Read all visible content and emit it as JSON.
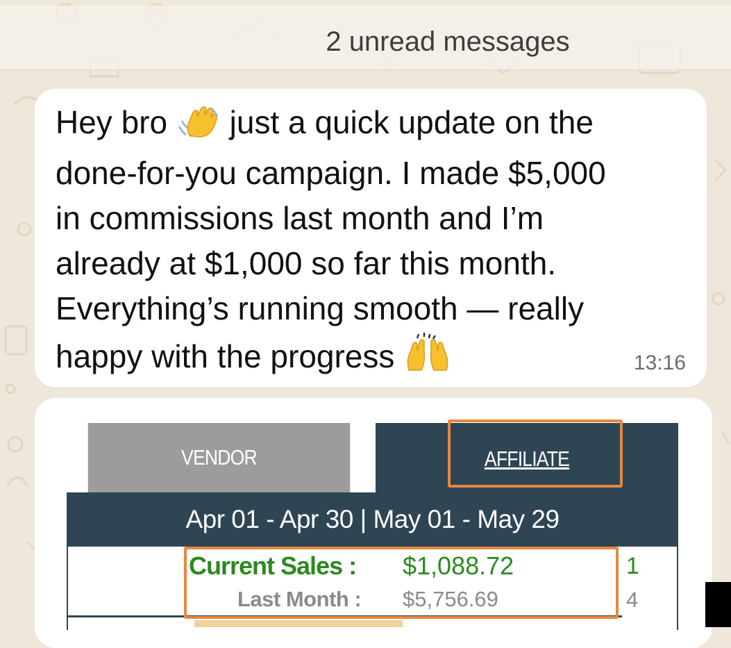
{
  "unread": {
    "label": "2 unread messages"
  },
  "message": {
    "lines": [
      "Hey bro",
      "just a quick update on the",
      "done-for-you campaign. I made $5,000",
      "in commissions last month and I’m",
      "already at $1,000 so far this month.",
      "Everything’s running smooth — really",
      "happy with the progress"
    ],
    "time": "13:16",
    "emoji_1": "waving-hand",
    "emoji_2": "raising-hands"
  },
  "screenshot": {
    "tab_vendor": "VENDOR",
    "tab_affiliate": "AFFILIATE",
    "date_range": "Apr 01 - Apr 30 | May 01 - May 29",
    "current_sales_label": "Current Sales :",
    "current_sales_value": "$1,088.72",
    "last_month_label": "Last Month :",
    "last_month_value": "$5,756.69",
    "side_1": "1",
    "side_2": "4"
  },
  "colors": {
    "wallpaper": "#efe7da",
    "bubble": "#ffffff",
    "header_dark": "#2e4554",
    "highlight": "#e8873e",
    "sales_green": "#2b8a1e"
  }
}
